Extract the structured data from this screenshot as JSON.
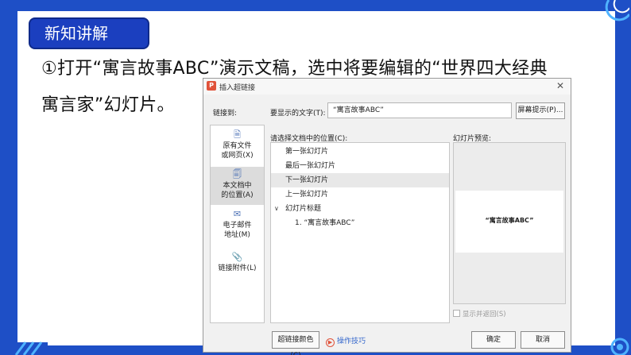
{
  "slide": {
    "section_tag": "新知讲解",
    "instruction_line1": "①打开“寓言故事ABC”演示文稿，选中将要编辑的“世界四大经典",
    "instruction_line2": "寓言家”幻灯片。"
  },
  "dialog": {
    "logo": "P",
    "title": "插入超链接",
    "close_glyph": "✕",
    "link_to_label": "链接到:",
    "display_text_label": "要显示的文字(T):",
    "display_text_value": "“寓言故事ABC”",
    "screentip_button": "屏幕提示(P)...",
    "nav": [
      {
        "icon": "file-web-icon",
        "glyph": "🗎",
        "line1": "原有文件",
        "line2": "或网页(X)"
      },
      {
        "icon": "document-place-icon",
        "glyph": "🗐",
        "line1": "本文档中",
        "line2": "的位置(A)"
      },
      {
        "icon": "email-icon",
        "glyph": "✉",
        "line1": "电子邮件",
        "line2": "地址(M)"
      },
      {
        "icon": "paperclip-icon",
        "glyph": "📎",
        "line1": "链接附件(L)",
        "line2": ""
      }
    ],
    "selected_nav": "本文档中的位置(A)",
    "choose_place_label": "请选择文档中的位置(C):",
    "tree_items": [
      "第一张幻灯片",
      "最后一张幻灯片",
      "下一张幻灯片",
      "上一张幻灯片",
      "幻灯片标题",
      "1. “寓言故事ABC”"
    ],
    "highlighted_item": "下一张幻灯片",
    "preview_label": "幻灯片预览:",
    "preview_text": "“寓言故事ABC”",
    "show_and_return": "显示并返回(S)",
    "hyperlink_color_button": "超链接颜色(C)",
    "tips_link": "操作技巧",
    "ok_button": "确定",
    "cancel_button": "取消"
  },
  "colors": {
    "frame": "#1e4fc6",
    "tag": "#1b3fbf",
    "link": "#3366cc"
  }
}
